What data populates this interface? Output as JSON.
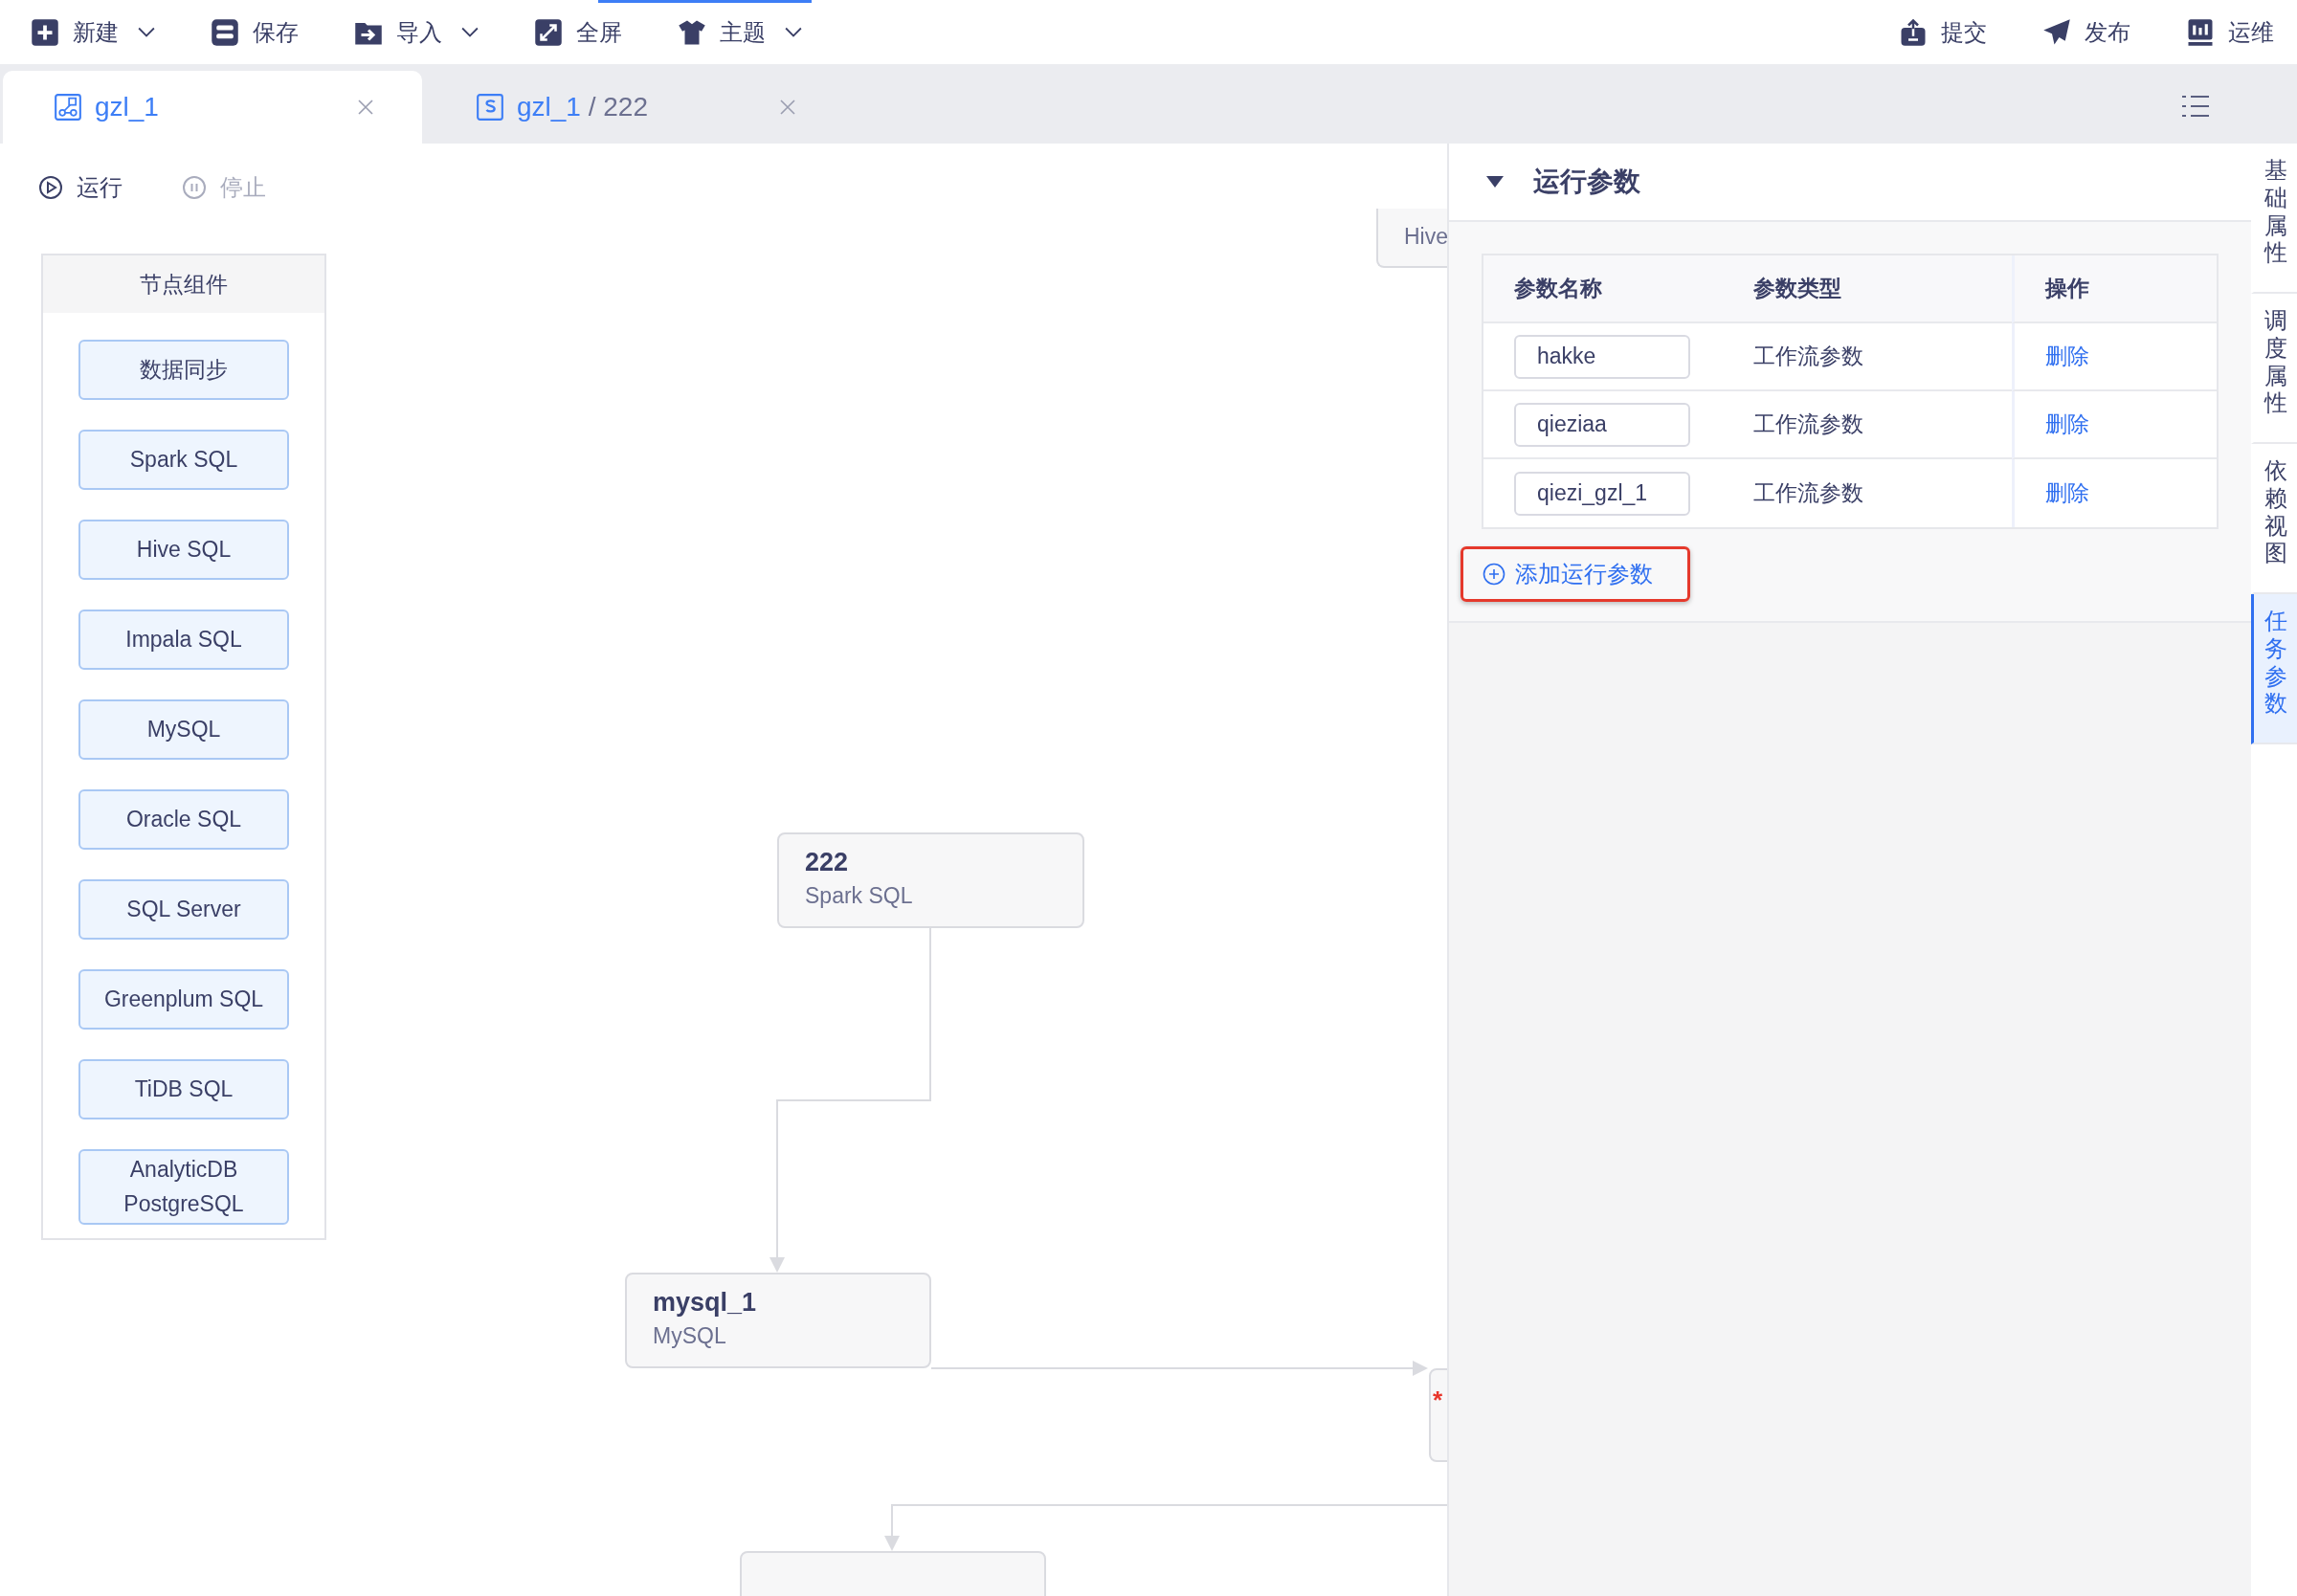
{
  "toolbar": {
    "left": [
      {
        "label": "新建",
        "kind": "plus",
        "dropdown": true
      },
      {
        "label": "保存",
        "kind": "save",
        "dropdown": false
      },
      {
        "label": "导入",
        "kind": "import",
        "dropdown": true
      },
      {
        "label": "全屏",
        "kind": "fullscreen",
        "dropdown": false
      },
      {
        "label": "主题",
        "kind": "shirt",
        "dropdown": true
      }
    ],
    "right": [
      {
        "label": "提交",
        "kind": "upload"
      },
      {
        "label": "发布",
        "kind": "plane"
      },
      {
        "label": "运维",
        "kind": "chart"
      }
    ]
  },
  "tabs": [
    {
      "kind": "workflow",
      "path": "gzl_1",
      "selected": true
    },
    {
      "kind": "sql",
      "path": "gzl_1",
      "separator": "/",
      "name": "222",
      "selected": false
    }
  ],
  "run_controls": [
    {
      "label": "运行",
      "kind": "play",
      "disabled": false
    },
    {
      "label": "停止",
      "kind": "pause",
      "disabled": true
    }
  ],
  "palette": {
    "title": "节点组件",
    "items": [
      "数据同步",
      "Spark SQL",
      "Hive SQL",
      "Impala SQL",
      "MySQL",
      "Oracle SQL",
      "SQL Server",
      "Greenplum SQL",
      "TiDB SQL",
      "AnalyticDB PostgreSQL"
    ]
  },
  "canvas": {
    "nodes": [
      {
        "name": "222",
        "type": "Spark SQL"
      },
      {
        "name": "mysql_1",
        "type": "MySQL"
      },
      {
        "type": "Hive"
      },
      {
        "required_mark": "*"
      }
    ]
  },
  "parameters_panel": {
    "title": "运行参数",
    "expanded": true,
    "columns": [
      "参数名称",
      "参数类型",
      "操作"
    ],
    "rows": [
      {
        "name": "hakke",
        "type": "工作流参数",
        "action": "删除"
      },
      {
        "name": "qieziaa",
        "type": "工作流参数",
        "action": "删除"
      },
      {
        "name": "qiezi_gzl_1",
        "type": "工作流参数",
        "action": "删除"
      }
    ],
    "add_button": "添加运行参数"
  },
  "side_tabs": [
    {
      "label": "基础属性",
      "selected": false
    },
    {
      "label": "调度属性",
      "selected": false
    },
    {
      "label": "依赖视图",
      "selected": false
    },
    {
      "label": "任务参数",
      "selected": true
    }
  ]
}
